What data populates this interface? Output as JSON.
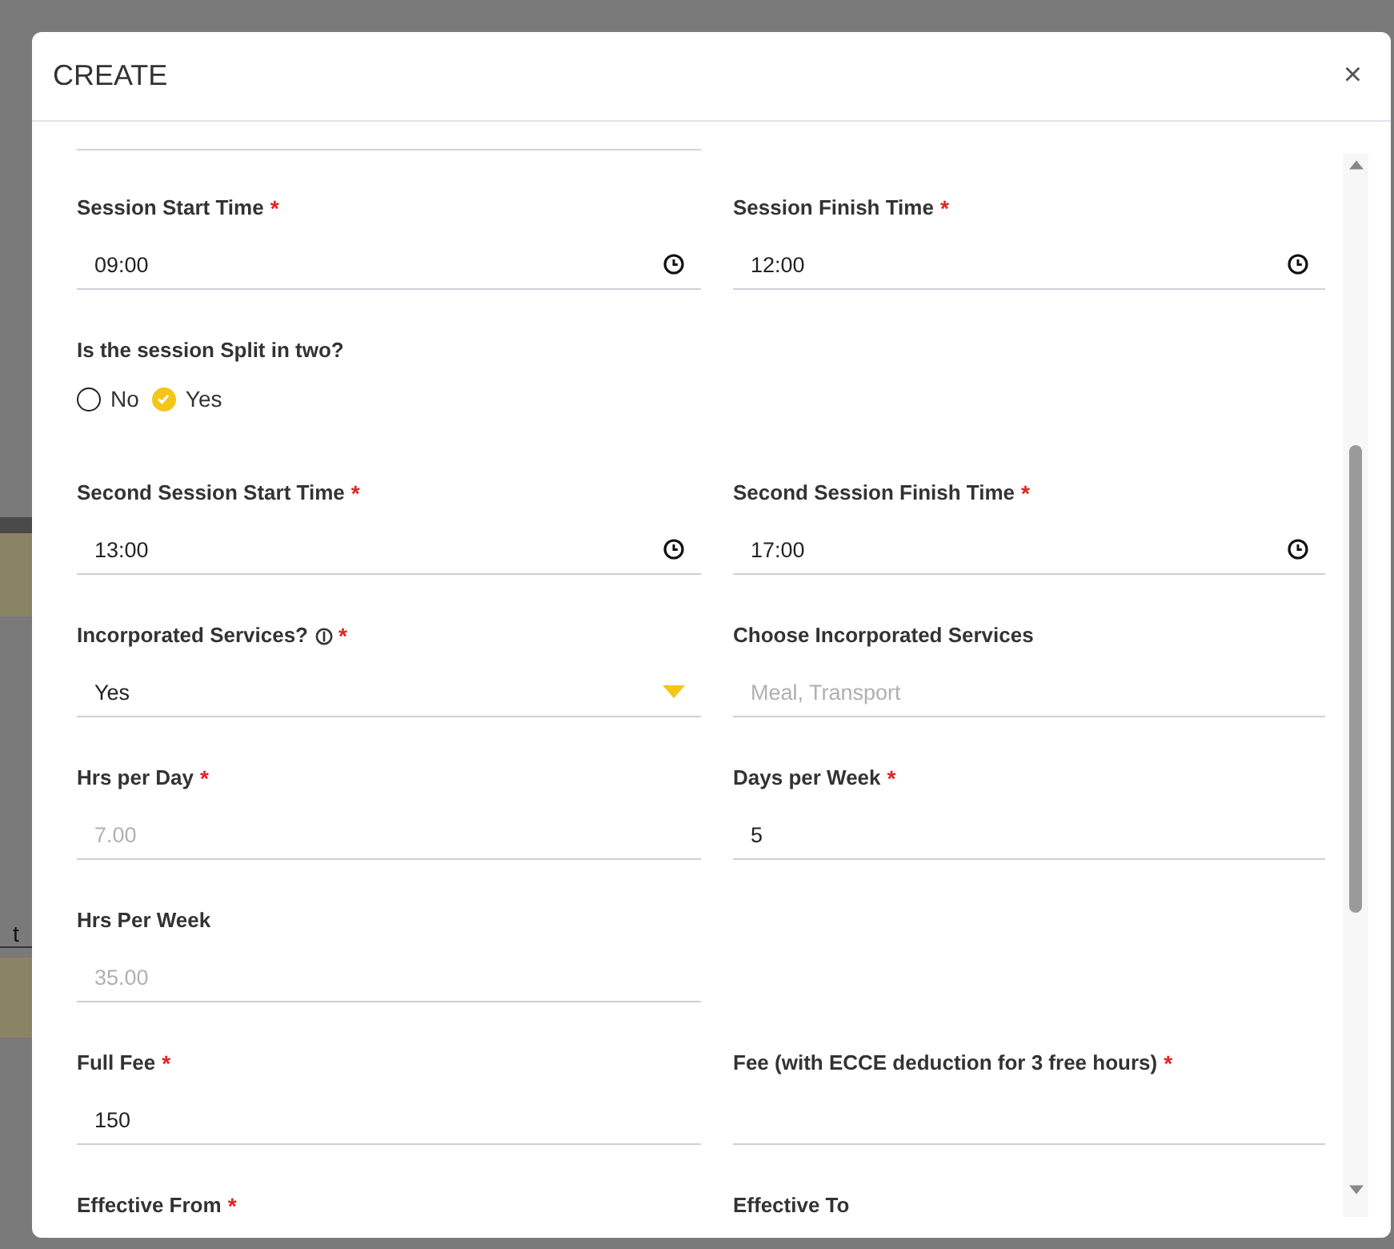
{
  "backdrop": {
    "text": "t"
  },
  "dialog": {
    "title": "CREATE",
    "close": "×"
  },
  "rows": [
    [
      {
        "kind": "time",
        "label": "Session Start Time",
        "required_mark": "*",
        "value": "09:00"
      },
      {
        "kind": "time",
        "label": "Session Finish Time",
        "required_mark": "*",
        "value": "12:00"
      }
    ],
    [
      {
        "kind": "radio",
        "label": "Is the session Split in two?",
        "options": [
          {
            "label": "No",
            "selected": false
          },
          {
            "label": "Yes",
            "selected": true
          }
        ]
      }
    ],
    [
      {
        "kind": "time",
        "label": "Second Session Start Time",
        "required_mark": "*",
        "value": "13:00"
      },
      {
        "kind": "time",
        "label": "Second Session Finish Time",
        "required_mark": "*",
        "value": "17:00"
      }
    ],
    [
      {
        "kind": "select",
        "label": "Incorporated Services?",
        "info_icon": true,
        "required_mark": "*",
        "value": "Yes"
      },
      {
        "kind": "text",
        "label": "Choose Incorporated Services",
        "placeholder": "Meal, Transport"
      }
    ],
    [
      {
        "kind": "text",
        "label": "Hrs per Day",
        "required_mark": "*",
        "value": "7.00",
        "disabled": true
      },
      {
        "kind": "text",
        "label": "Days per Week",
        "required_mark": "*",
        "value": "5",
        "disabled": false
      }
    ],
    [
      {
        "kind": "text",
        "label": "Hrs Per Week",
        "value": "35.00",
        "disabled": true
      }
    ],
    [
      {
        "kind": "text",
        "label": "Full Fee",
        "required_mark": "*",
        "value": "150",
        "disabled": false
      },
      {
        "kind": "text",
        "label": "Fee (with ECCE deduction for 3 free hours)",
        "required_mark": "*"
      }
    ],
    [
      {
        "kind": "text",
        "label": "Effective From",
        "required_mark": "*"
      },
      {
        "kind": "text",
        "label": "Effective To"
      }
    ]
  ]
}
